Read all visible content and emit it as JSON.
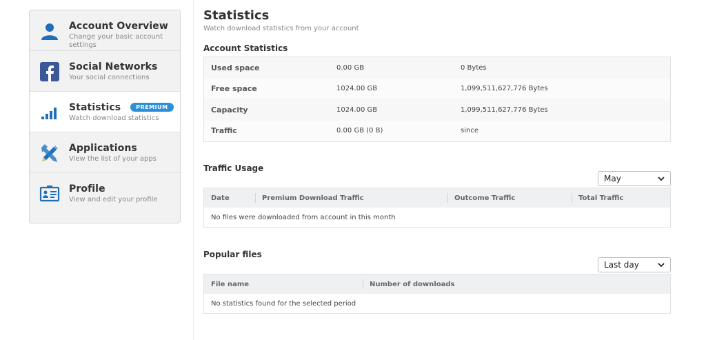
{
  "sidebar": {
    "items": [
      {
        "title": "Account Overview",
        "subtitle": "Change your basic account settings",
        "icon": "user-icon"
      },
      {
        "title": "Social Networks",
        "subtitle": "Your social connections",
        "icon": "facebook-icon"
      },
      {
        "title": "Statistics",
        "subtitle": "Watch download statistics",
        "icon": "bar-chart-icon",
        "badge": "PREMIUM",
        "active": true
      },
      {
        "title": "Applications",
        "subtitle": "View the list of your apps",
        "icon": "tools-icon"
      },
      {
        "title": "Profile",
        "subtitle": "View and edit your profile",
        "icon": "id-card-icon"
      }
    ]
  },
  "header": {
    "title": "Statistics",
    "subtitle": "Watch download statistics from your account"
  },
  "account_statistics": {
    "title": "Account Statistics",
    "rows": [
      {
        "label": "Used space",
        "gb": "0.00 GB",
        "bytes": "0 Bytes"
      },
      {
        "label": "Free space",
        "gb": "1024.00 GB",
        "bytes": "1,099,511,627,776 Bytes"
      },
      {
        "label": "Capacity",
        "gb": "1024.00 GB",
        "bytes": "1,099,511,627,776 Bytes"
      },
      {
        "label": "Traffic",
        "gb": "0.00 GB (0 B)",
        "bytes": "since"
      }
    ]
  },
  "traffic_usage": {
    "title": "Traffic Usage",
    "select_value": "May",
    "columns": [
      "Date",
      "Premium Download Traffic",
      "Outcome Traffic",
      "Total Traffic"
    ],
    "empty_message": "No files were downloaded from account in this month"
  },
  "popular_files": {
    "title": "Popular files",
    "select_value": "Last day",
    "columns": [
      "File name",
      "Number of downloads"
    ],
    "empty_message": "No statistics found for the selected period"
  },
  "colors": {
    "accent": "#2d8fd9",
    "icon_blue": "#1f6fb8",
    "facebook": "#3b5998"
  }
}
